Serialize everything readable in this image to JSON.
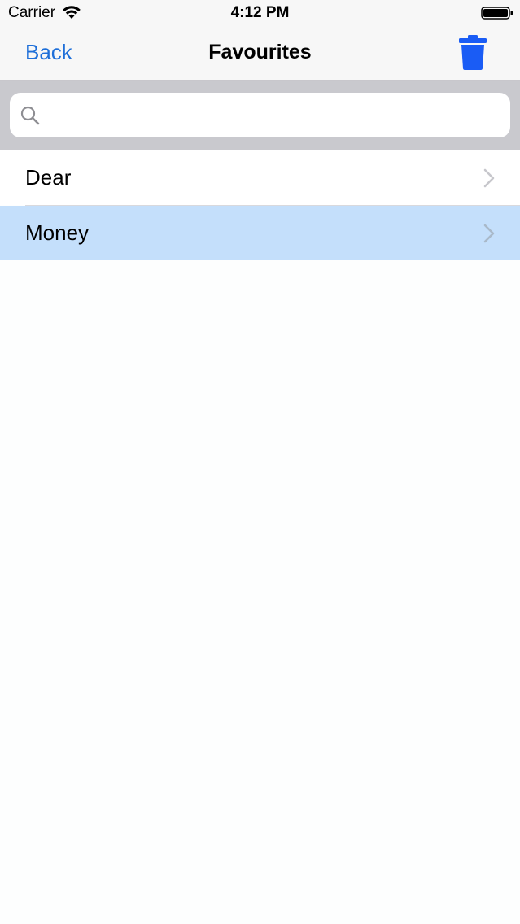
{
  "status_bar": {
    "carrier": "Carrier",
    "time": "4:12 PM"
  },
  "nav_bar": {
    "back_label": "Back",
    "title": "Favourites",
    "delete_icon": "trash-icon"
  },
  "search": {
    "placeholder": "",
    "value": ""
  },
  "list": {
    "items": [
      {
        "label": "Dear",
        "selected": false
      },
      {
        "label": "Money",
        "selected": true
      }
    ]
  },
  "colors": {
    "accent": "#1e6fd9",
    "trash": "#1a5cf5",
    "selected_row": "#c4dffb"
  }
}
